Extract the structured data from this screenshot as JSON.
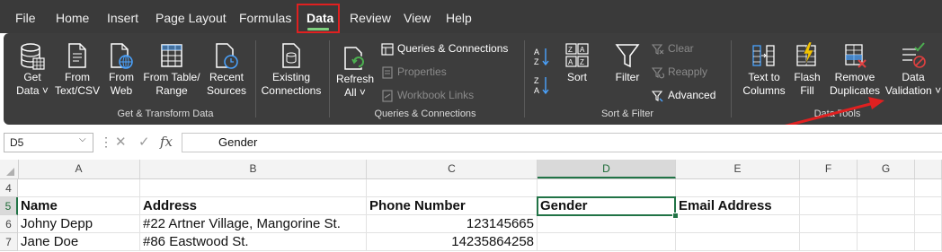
{
  "menu": {
    "items": [
      "File",
      "Home",
      "Insert",
      "Page Layout",
      "Formulas",
      "Data",
      "Review",
      "View",
      "Help"
    ],
    "active": "Data"
  },
  "ribbon": {
    "get_transform": {
      "get_data": [
        "Get",
        "Data"
      ],
      "from_text_csv": [
        "From",
        "Text/CSV"
      ],
      "from_web": [
        "From",
        "Web"
      ],
      "from_table_range": [
        "From Table/",
        "Range"
      ],
      "recent_sources": [
        "Recent",
        "Sources"
      ],
      "existing_connections": [
        "Existing",
        "Connections"
      ],
      "label": "Get & Transform Data"
    },
    "queries": {
      "refresh_all": [
        "Refresh",
        "All"
      ],
      "queries_connections": "Queries & Connections",
      "properties": "Properties",
      "workbook_links": "Workbook Links",
      "label": "Queries & Connections"
    },
    "sort_filter": {
      "sort": "Sort",
      "filter": "Filter",
      "clear": "Clear",
      "reapply": "Reapply",
      "advanced": "Advanced",
      "label": "Sort & Filter"
    },
    "data_tools": {
      "text_to_columns": [
        "Text to",
        "Columns"
      ],
      "flash_fill": [
        "Flash",
        "Fill"
      ],
      "remove_duplicates": [
        "Remove",
        "Duplicates"
      ],
      "data_validation": [
        "Data",
        "Validation"
      ],
      "label": "Data Tools"
    }
  },
  "formula_bar": {
    "name_box": "D5",
    "formula": "Gender"
  },
  "grid": {
    "columns": [
      "A",
      "B",
      "C",
      "D",
      "E",
      "F",
      "G"
    ],
    "selected_column": "D",
    "rows": [
      {
        "num": "4",
        "cells": [
          "",
          "",
          "",
          "",
          ""
        ]
      },
      {
        "num": "5",
        "cells": [
          "Name",
          "Address",
          "Phone Number",
          "Gender",
          "Email Address"
        ]
      },
      {
        "num": "6",
        "cells": [
          "Johny Depp",
          "#22 Artner Village, Mangorine St.",
          "123145665",
          "",
          ""
        ]
      },
      {
        "num": "7",
        "cells": [
          "Jane Doe",
          "#86 Eastwood St.",
          "14235864258",
          "",
          ""
        ]
      }
    ],
    "selected_row": "5"
  },
  "colors": {
    "accent_red": "#e02020",
    "excel_green": "#217346",
    "ribbon_bg": "#3d3d3d",
    "menubar_bg": "#3a3a3a"
  }
}
